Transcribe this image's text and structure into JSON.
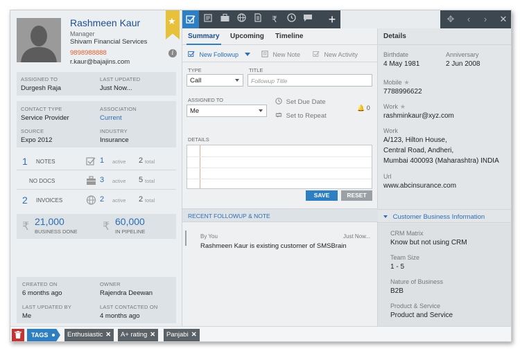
{
  "contact": {
    "name": "Rashmeen Kaur",
    "title": "Manager",
    "company": "Shivam Financial Services",
    "phone": "9898988888",
    "email": "r.kaur@bajajins.com"
  },
  "assignment": {
    "assigned_to_label": "ASSIGNED TO",
    "assigned_to": "Durgesh Raja",
    "last_updated_label": "LAST UPDATED",
    "last_updated": "Just Now..."
  },
  "profile": {
    "contact_type_label": "CONTACT TYPE",
    "contact_type": "Service Provider",
    "association_label": "ASSOCIATION",
    "association": "Current",
    "source_label": "SOURCE",
    "source": "Expo 2012",
    "industry_label": "INDUSTRY",
    "industry": "Insurance"
  },
  "stats": [
    {
      "count": "1",
      "label": "NOTES",
      "active": "1",
      "active_label": "active",
      "total": "2",
      "total_label": "total",
      "icon": "check-square-icon"
    },
    {
      "count": "",
      "label": "NO DOCS",
      "active": "3",
      "active_label": "active",
      "total": "5",
      "total_label": "total",
      "icon": "briefcase-icon"
    },
    {
      "count": "2",
      "label": "INVOICES",
      "active": "2",
      "active_label": "active",
      "total": "2",
      "total_label": "total",
      "icon": "globe-icon"
    }
  ],
  "money": {
    "business_done": "21,000",
    "business_done_label": "BUSINESS DONE",
    "pipeline": "60,000",
    "pipeline_label": "IN PIPELINE"
  },
  "meta": {
    "created_on_label": "CREATED ON",
    "created_on": "6 months ago",
    "owner_label": "OWNER",
    "owner": "Rajendra Deewan",
    "last_updated_by_label": "LAST UPDATED BY",
    "last_updated_by": "Me",
    "last_contacted_label": "LAST CONTACTED ON",
    "last_contacted": "4 months ago"
  },
  "toolbar": {
    "icons": [
      "check-square-icon",
      "notes-icon",
      "briefcase-icon",
      "globe-icon",
      "document-icon",
      "rupee-icon",
      "history-icon",
      "chat-icon"
    ],
    "plus": "+"
  },
  "tabs": [
    "Summary",
    "Upcoming",
    "Timeline"
  ],
  "subtabs": {
    "new_followup": "New Followup",
    "new_note": "New Note",
    "new_activity": "New Activity"
  },
  "form": {
    "type_label": "TYPE",
    "type_value": "Call",
    "title_label": "TITLE",
    "title_placeholder": "Followup Title",
    "assigned_to_label": "ASSIGNED TO",
    "assigned_to_value": "Me",
    "set_due_date": "Set Due Date",
    "set_to_repeat": "Set to Repeat",
    "alarm_count": "0",
    "details_label": "DETAILS",
    "save": "SAVE",
    "reset": "RESET"
  },
  "recent": {
    "header": "RECENT FOLLOWUP & NOTE",
    "by": "By You",
    "time": "Just Now...",
    "text": "Rashmeen Kaur is existing customer of SMSBrain"
  },
  "details": {
    "header": "Details",
    "birthdate_label": "Birthdate",
    "birthdate": "4 May 1981",
    "anniversary_label": "Anniversary",
    "anniversary": "2 Jun 2008",
    "mobile_label": "Mobile",
    "mobile": "7788996622",
    "work_email_label": "Work",
    "work_email": "rashminkaur@xyz.com",
    "work_addr_label": "Work",
    "addr1": "A/123, Hilton House,",
    "addr2": "Central Road, Andheri,",
    "addr3": "Mumbai 400093 (Maharashtra) INDIA",
    "url_label": "Url",
    "url": "www.abcinsurance.com"
  },
  "cbi": {
    "header": "Customer Business Information",
    "crm_label": "CRM Matrix",
    "crm": "Know but not using CRM",
    "team_label": "Team Size",
    "team": "1 - 5",
    "nature_label": "Nature of Business",
    "nature": "B2B",
    "product_label": "Product & Service",
    "product": "Product and Service"
  },
  "tags": {
    "label": "TAGS",
    "items": [
      "Enthusiastic",
      "A+ rating",
      "Panjabi"
    ]
  },
  "colors": {
    "accent": "#2d7fc1",
    "toolbar": "#3d4750",
    "bookmark": "#e7c13a",
    "phone": "#e25b2c",
    "trash": "#c83232"
  }
}
